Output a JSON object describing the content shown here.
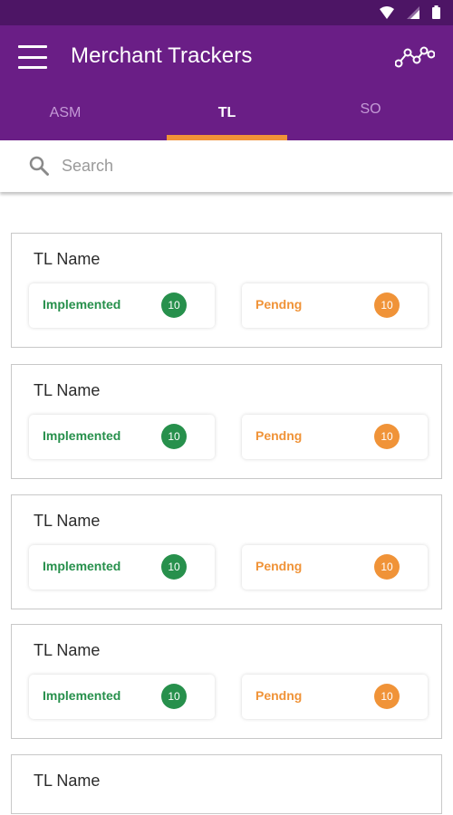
{
  "app": {
    "title": "Merchant Trackers",
    "colors": {
      "primary": "#6a1e86",
      "status_bar": "#4d1565",
      "accent": "#f09338",
      "implemented": "#27904c",
      "pending": "#f09338"
    }
  },
  "tabs": [
    {
      "label": "ASM",
      "selected": false
    },
    {
      "label": "TL",
      "selected": true
    },
    {
      "label": "SO",
      "selected": false
    }
  ],
  "search": {
    "placeholder": "Search",
    "value": ""
  },
  "cards": [
    {
      "name": "TL Name",
      "implemented_label": "Implemented",
      "implemented_count": "10",
      "pending_label": "Pendng",
      "pending_count": "10"
    },
    {
      "name": "TL Name",
      "implemented_label": "Implemented",
      "implemented_count": "10",
      "pending_label": "Pendng",
      "pending_count": "10"
    },
    {
      "name": "TL Name",
      "implemented_label": "Implemented",
      "implemented_count": "10",
      "pending_label": "Pendng",
      "pending_count": "10"
    },
    {
      "name": "TL Name",
      "implemented_label": "Implemented",
      "implemented_count": "10",
      "pending_label": "Pendng",
      "pending_count": "10"
    },
    {
      "name": "TL Name"
    }
  ],
  "icons": [
    "wifi-icon",
    "signal-icon",
    "battery-icon",
    "menu-icon",
    "trend-icon",
    "search-icon"
  ]
}
